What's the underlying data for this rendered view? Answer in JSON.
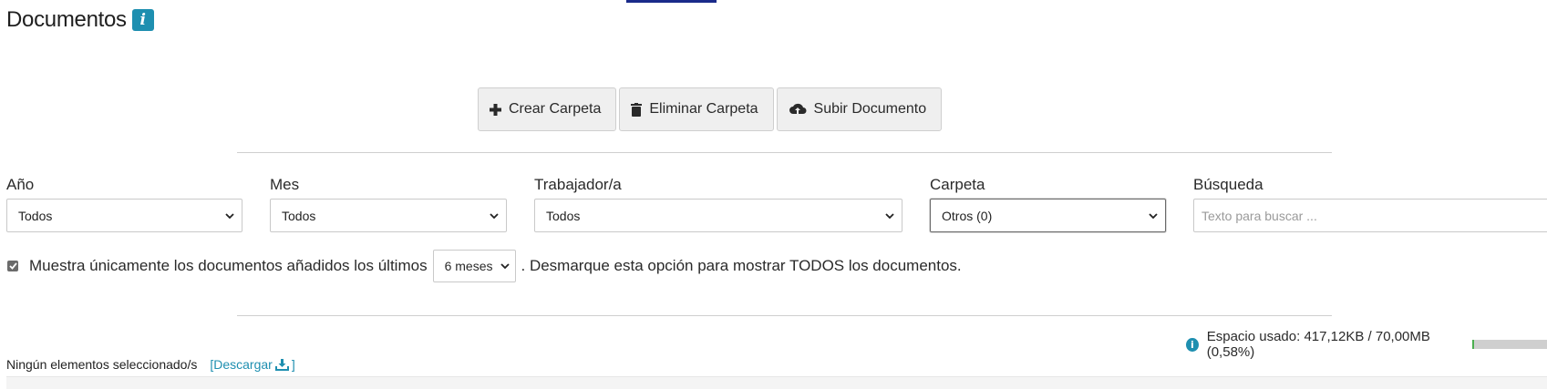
{
  "header": {
    "title": "Documentos",
    "info_badge": "i"
  },
  "toolbar": {
    "create_folder": "Crear Carpeta",
    "delete_folder": "Eliminar Carpeta",
    "upload_document": "Subir Documento"
  },
  "filters": {
    "year": {
      "label": "Año",
      "value": "Todos"
    },
    "month": {
      "label": "Mes",
      "value": "Todos"
    },
    "worker": {
      "label": "Trabajador/a",
      "value": "Todos"
    },
    "folder": {
      "label": "Carpeta",
      "value": "Otros (0)"
    },
    "search": {
      "label": "Búsqueda",
      "placeholder": "Texto para buscar ..."
    }
  },
  "recent": {
    "checked": true,
    "text_before": "Muestra únicamente los documentos añadidos los últimos",
    "period": "6 meses",
    "text_after": ". Desmarque esta opción para mostrar TODOS los documentos."
  },
  "storage": {
    "label": "Espacio usado: 417,12KB / 70,00MB (0,58%)",
    "percent_used": 0.58
  },
  "selection": {
    "status": "Ningún elementos seleccionado/s",
    "download_open": "[Descargar",
    "download_close": "]"
  },
  "colors": {
    "accent": "#1e8fb0",
    "progress": "#4caf50",
    "top_accent": "#1a2a8a"
  }
}
